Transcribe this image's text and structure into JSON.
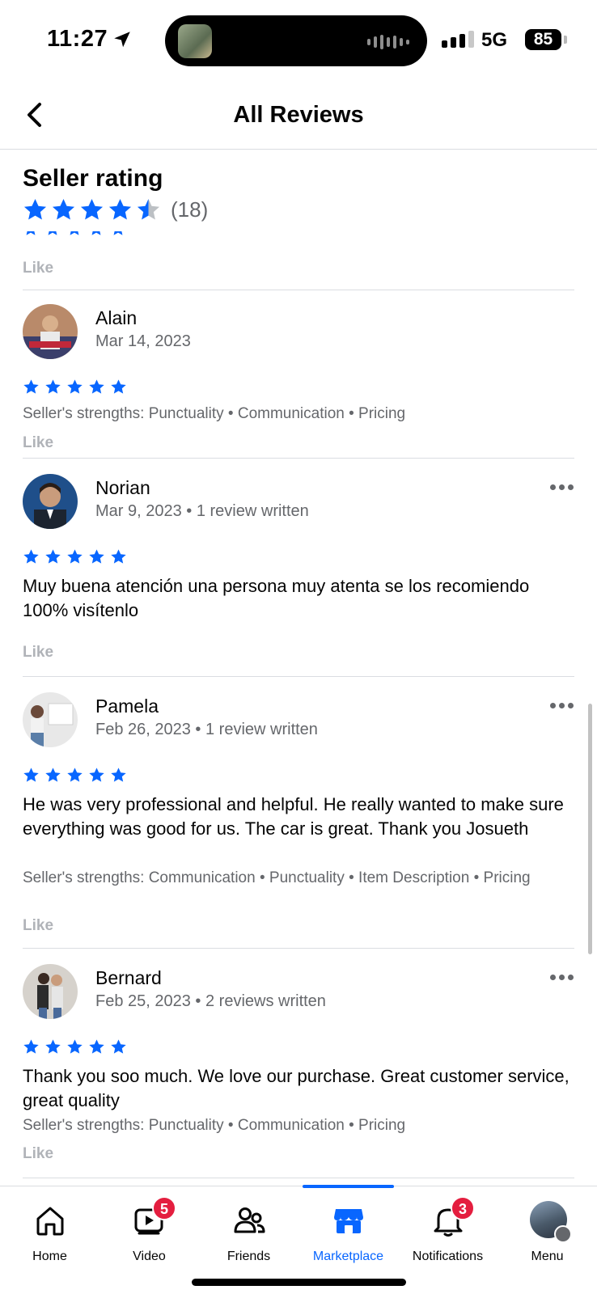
{
  "status_bar": {
    "time": "11:27",
    "network": "5G",
    "battery": "85",
    "icons": [
      "location-arrow-icon",
      "signal-icon",
      "battery-icon"
    ]
  },
  "header": {
    "title": "All Reviews",
    "back_icon": "chevron-left-icon"
  },
  "summary": {
    "title": "Seller rating",
    "rating_stars": 4.5,
    "count": "(18)"
  },
  "like_label": "Like",
  "reviews": [
    {
      "name": "Alain",
      "date": "Mar 14, 2023",
      "meta": "",
      "stars": 5,
      "text": "",
      "strengths": "Seller's strengths: Punctuality • Communication • Pricing",
      "like": "Like"
    },
    {
      "name": "Norian",
      "date": "Mar 9, 2023",
      "meta": "Mar 9, 2023 • 1 review written",
      "stars": 5,
      "text": "Muy buena atención una persona muy atenta se los recomiendo 100% visítenlo",
      "strengths": "",
      "like": "Like"
    },
    {
      "name": "Pamela",
      "date": "Feb 26, 2023",
      "meta": "Feb 26, 2023 • 1 review written",
      "stars": 5,
      "text": "He was very professional and helpful. He really wanted to make sure everything was good for us. The car is great. Thank you Josueth",
      "strengths": "Seller's strengths: Communication • Punctuality • Item Description • Pricing",
      "like": "Like"
    },
    {
      "name": "Bernard",
      "date": "Feb 25, 2023",
      "meta": "Feb 25, 2023 • 2 reviews written",
      "stars": 5,
      "text": "Thank you soo much. We love our purchase. Great customer service, great quality",
      "strengths": "Seller's strengths: Punctuality • Communication • Pricing",
      "like": "Like"
    }
  ],
  "tabs": [
    {
      "label": "Home",
      "icon": "home-icon"
    },
    {
      "label": "Video",
      "icon": "video-icon",
      "badge": "5"
    },
    {
      "label": "Friends",
      "icon": "friends-icon"
    },
    {
      "label": "Marketplace",
      "icon": "marketplace-icon",
      "active": true
    },
    {
      "label": "Notifications",
      "icon": "bell-icon",
      "badge": "3"
    },
    {
      "label": "Menu",
      "icon": "menu-avatar"
    }
  ],
  "colors": {
    "accent": "#0866ff",
    "star": "#0866ff",
    "badge": "#e41e3f",
    "secondary_text": "#65676b",
    "like_text": "#b0b3b8"
  }
}
